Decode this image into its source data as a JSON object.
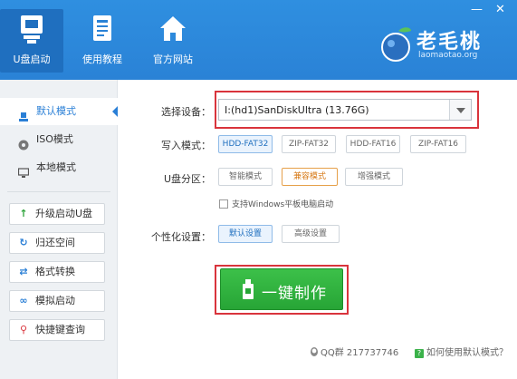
{
  "window": {
    "minimize_glyph": "—",
    "close_glyph": "✕"
  },
  "nav": [
    {
      "label": "U盘启动",
      "icon": "usb-drive-icon"
    },
    {
      "label": "使用教程",
      "icon": "book-icon"
    },
    {
      "label": "官方网站",
      "icon": "home-icon"
    }
  ],
  "brand": {
    "name": "老毛桃",
    "url": "laomaotao.org"
  },
  "sidebar": {
    "modes": [
      {
        "label": "默认模式",
        "icon": "person-icon",
        "active": true
      },
      {
        "label": "ISO模式",
        "icon": "disc-icon",
        "active": false
      },
      {
        "label": "本地模式",
        "icon": "monitor-icon",
        "active": false
      }
    ],
    "tools": [
      {
        "label": "升级启动U盘",
        "icon": "up-arrow-icon",
        "glyph": "↑"
      },
      {
        "label": "归还空间",
        "icon": "refresh-icon",
        "glyph": "↻"
      },
      {
        "label": "格式转换",
        "icon": "swap-icon",
        "glyph": "⇄"
      },
      {
        "label": "模拟启动",
        "icon": "link-icon",
        "glyph": "∞"
      },
      {
        "label": "快捷键查询",
        "icon": "search-icon",
        "glyph": "⚲"
      }
    ]
  },
  "form": {
    "device_label": "选择设备：",
    "device_value": "I:(hd1)SanDiskUltra (13.76G)",
    "write_mode_label": "写入模式：",
    "write_modes": [
      "HDD-FAT32",
      "ZIP-FAT32",
      "HDD-FAT16",
      "ZIP-FAT16"
    ],
    "write_mode_selected": "HDD-FAT32",
    "partition_label": "U盘分区：",
    "partitions": [
      "智能模式",
      "兼容模式",
      "增强模式"
    ],
    "partition_selected": "兼容模式",
    "tablet_checkbox_label": "支持Windows平板电脑启动",
    "tablet_checked": false,
    "personalize_label": "个性化设置：",
    "personalize_options": [
      "默认设置",
      "高级设置"
    ],
    "personalize_selected": "默认设置"
  },
  "action": {
    "make_label": "一键制作"
  },
  "footer": {
    "qq_text": "QQ群 217737746",
    "help_text": "如何使用默认模式？"
  },
  "colors": {
    "header_blue": "#2a82d6",
    "accent_green": "#27a536",
    "highlight_red": "#d9343c"
  }
}
